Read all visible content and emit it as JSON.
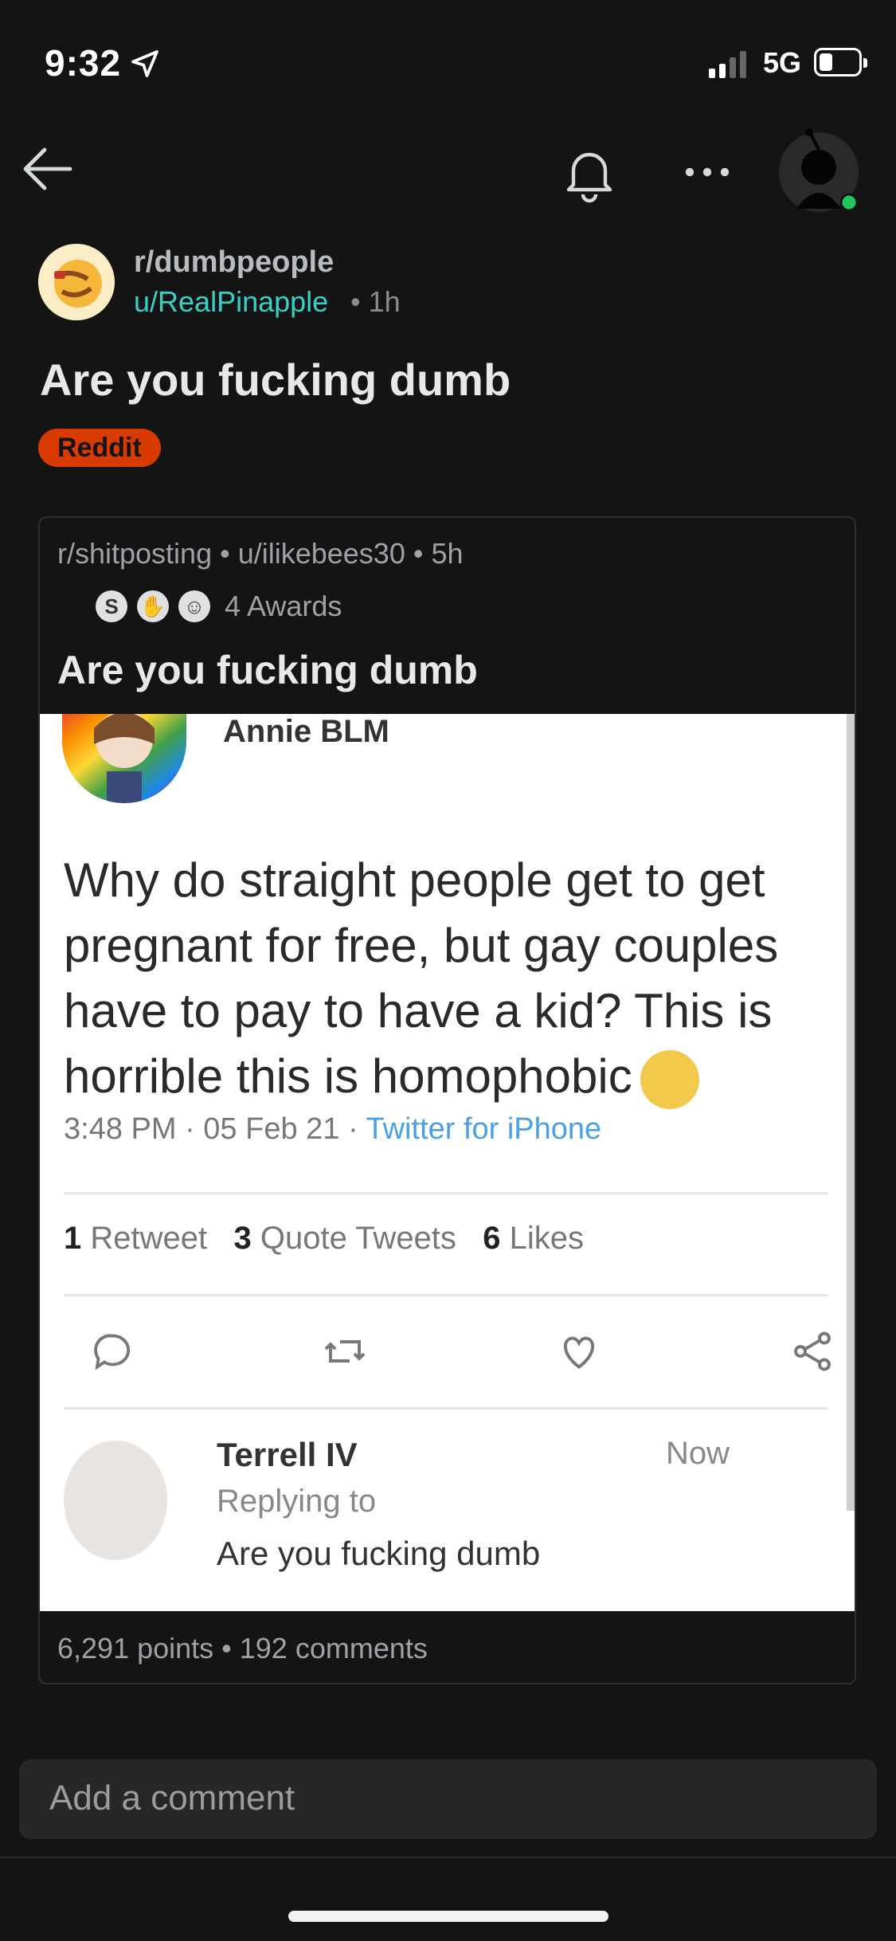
{
  "status_bar": {
    "time": "9:32",
    "network": "5G"
  },
  "post": {
    "subreddit": "r/dumbpeople",
    "author": "u/RealPinapple",
    "time": "• 1h",
    "title": "Are you fucking dumb",
    "flair": "Reddit"
  },
  "crosspost": {
    "meta": "r/shitposting • u/ilikebees30 • 5h",
    "awards": "4 Awards",
    "title": "Are you fucking dumb",
    "footer": "6,291 points • 192 comments"
  },
  "tweet": {
    "name": "Annie BLM",
    "text": "Why do straight people get to get pregnant for free, but gay couples have to pay to have a kid? This is horrible this is homophobic",
    "time": "3:48 PM · 05 Feb 21 · ",
    "via": "Twitter for iPhone",
    "retweets_count": "1",
    "retweets_label": "Retweet",
    "quotes_count": "3",
    "quotes_label": "Quote Tweets",
    "likes_count": "6",
    "likes_label": "Likes",
    "reply": {
      "name": "Terrell IV",
      "time": "Now",
      "replying_to": "Replying to",
      "text": "Are you fucking dumb"
    }
  },
  "comment_bar": {
    "placeholder": "Add a comment"
  },
  "colors": {
    "background": "#141414",
    "author": "#38d1c6",
    "flair": "#d93a00",
    "online": "#22c55e"
  },
  "icons": [
    "location-arrow-icon",
    "signal-icon",
    "battery-icon",
    "back-arrow-icon",
    "bell-icon",
    "more-icon",
    "reply-icon",
    "retweet-icon",
    "heart-icon",
    "share-icon"
  ]
}
